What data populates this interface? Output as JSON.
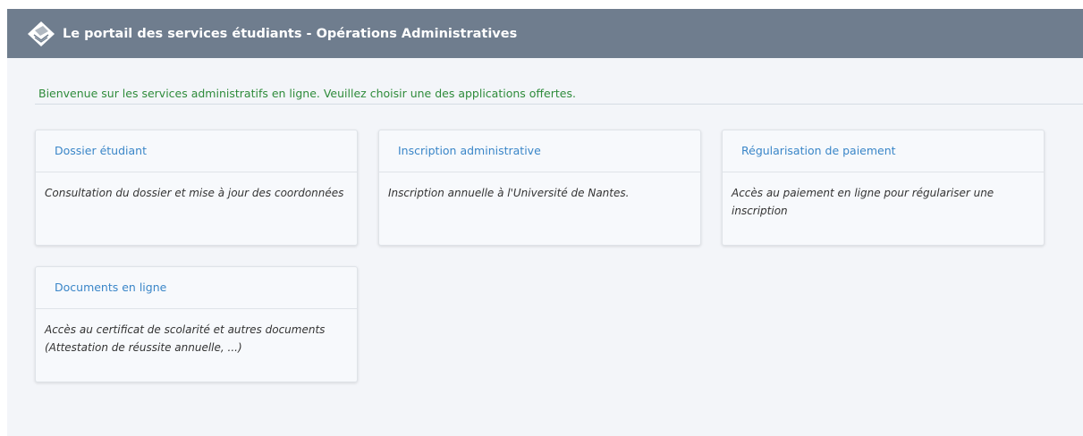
{
  "header": {
    "title": "Le portail des services étudiants - Opérations Administratives",
    "logo_icon": "diamond-book-logo-icon",
    "background_color": "#6f7d8e"
  },
  "welcome": {
    "text": "Bienvenue sur les services administratifs en ligne. Veuillez choisir une des applications offertes.",
    "color": "#2e8b3a"
  },
  "cards": [
    {
      "title": "Dossier étudiant",
      "description": "Consultation du dossier et mise à jour des coordonnées"
    },
    {
      "title": "Inscription administrative",
      "description": "Inscription annuelle à l'Université de Nantes."
    },
    {
      "title": "Régularisation de paiement",
      "description": "Accès au paiement en ligne pour régulariser une inscription"
    },
    {
      "title": "Documents en ligne",
      "description": "Accès au certificat de scolarité et autres documents (Attestation de réussite annuelle, ...)"
    }
  ],
  "colors": {
    "link": "#3a86c8",
    "page_background": "#f3f5f9"
  }
}
